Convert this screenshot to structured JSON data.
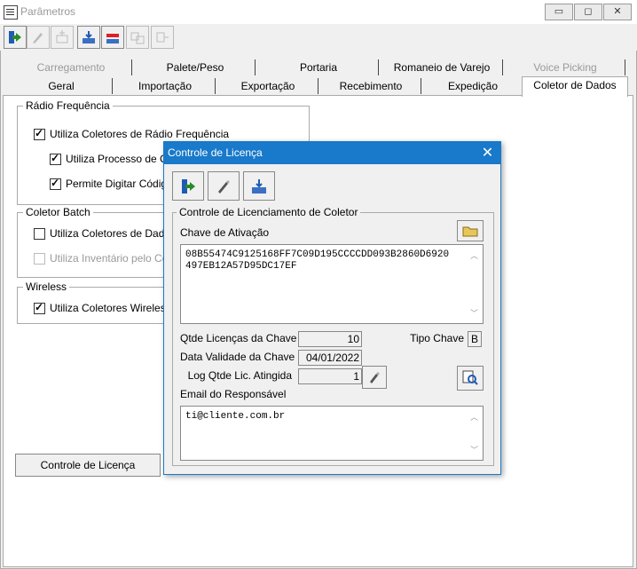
{
  "window": {
    "title": "Parâmetros",
    "minimize": "▭",
    "maximize": "◻",
    "close": "✕"
  },
  "tabs_row1": [
    "Carregamento",
    "Palete/Peso",
    "Portaria",
    "Romaneio de Varejo",
    "Voice Picking"
  ],
  "tabs_row2": [
    "Geral",
    "Importação",
    "Exportação",
    "Recebimento",
    "Expedição",
    "Coletor de Dados"
  ],
  "rf_group": {
    "title": "Rádio Frequência",
    "opt1": "Utiliza Coletores de Rádio Frequência",
    "opt2": "Utiliza Processo de Con",
    "opt3": "Permite Digitar Código d"
  },
  "batch_group": {
    "title": "Coletor Batch",
    "opt1": "Utiliza Coletores de Dados",
    "opt2": "Utiliza Inventário pelo Colet"
  },
  "wireless_group": {
    "title": "Wireless",
    "opt1": "Utiliza Coletores Wireless"
  },
  "license_button": "Controle de Licença",
  "dialog": {
    "title": "Controle de Licença",
    "close": "✕",
    "group_title": "Controle de Licenciamento de Coletor",
    "key_label": "Chave de Ativação",
    "key_line1": "08B55474C9125168FF7C09D195CCCCDD093B2860D6920",
    "key_line2": "497EB12A57D95DC17EF",
    "qty_label": "Qtde Licenças da Chave",
    "qty_value": "10",
    "type_label": "Tipo Chave",
    "type_value": "B",
    "validity_label": "Data Validade da Chave",
    "validity_value": "04/01/2022",
    "log_label": "Log Qtde Lic. Atingida",
    "log_value": "1",
    "email_label": "Email do Responsável",
    "email_value": "ti@cliente.com.br"
  },
  "colors": {
    "accent": "#1979ca",
    "disabled": "#999999"
  }
}
